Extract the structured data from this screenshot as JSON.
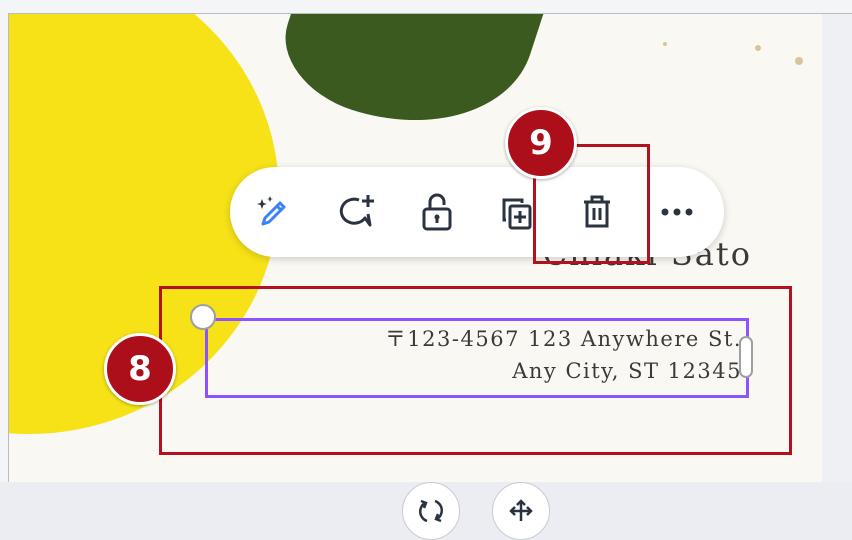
{
  "canvas": {
    "name": "Chiaki Sato",
    "address_line1": "〒123-4567 123 Anywhere St.",
    "address_line2": "Any City, ST 12345"
  },
  "toolbar": {
    "icons": [
      "magic-pen-icon",
      "add-comment-icon",
      "lock-icon",
      "duplicate-icon",
      "trash-icon",
      "more-icon"
    ]
  },
  "annotations": {
    "badge_8": "8",
    "badge_9": "9",
    "highlight_color": "#b4111e",
    "badge_color": "#ad0f1a"
  },
  "colors": {
    "selection": "#8c52ff",
    "yellow_shape": "#f6e217",
    "green_shape": "#3b5a1f",
    "icon_accent": "#3b82f6"
  },
  "bottom_controls": {
    "icons": [
      "rotate-icon",
      "move-icon"
    ]
  }
}
